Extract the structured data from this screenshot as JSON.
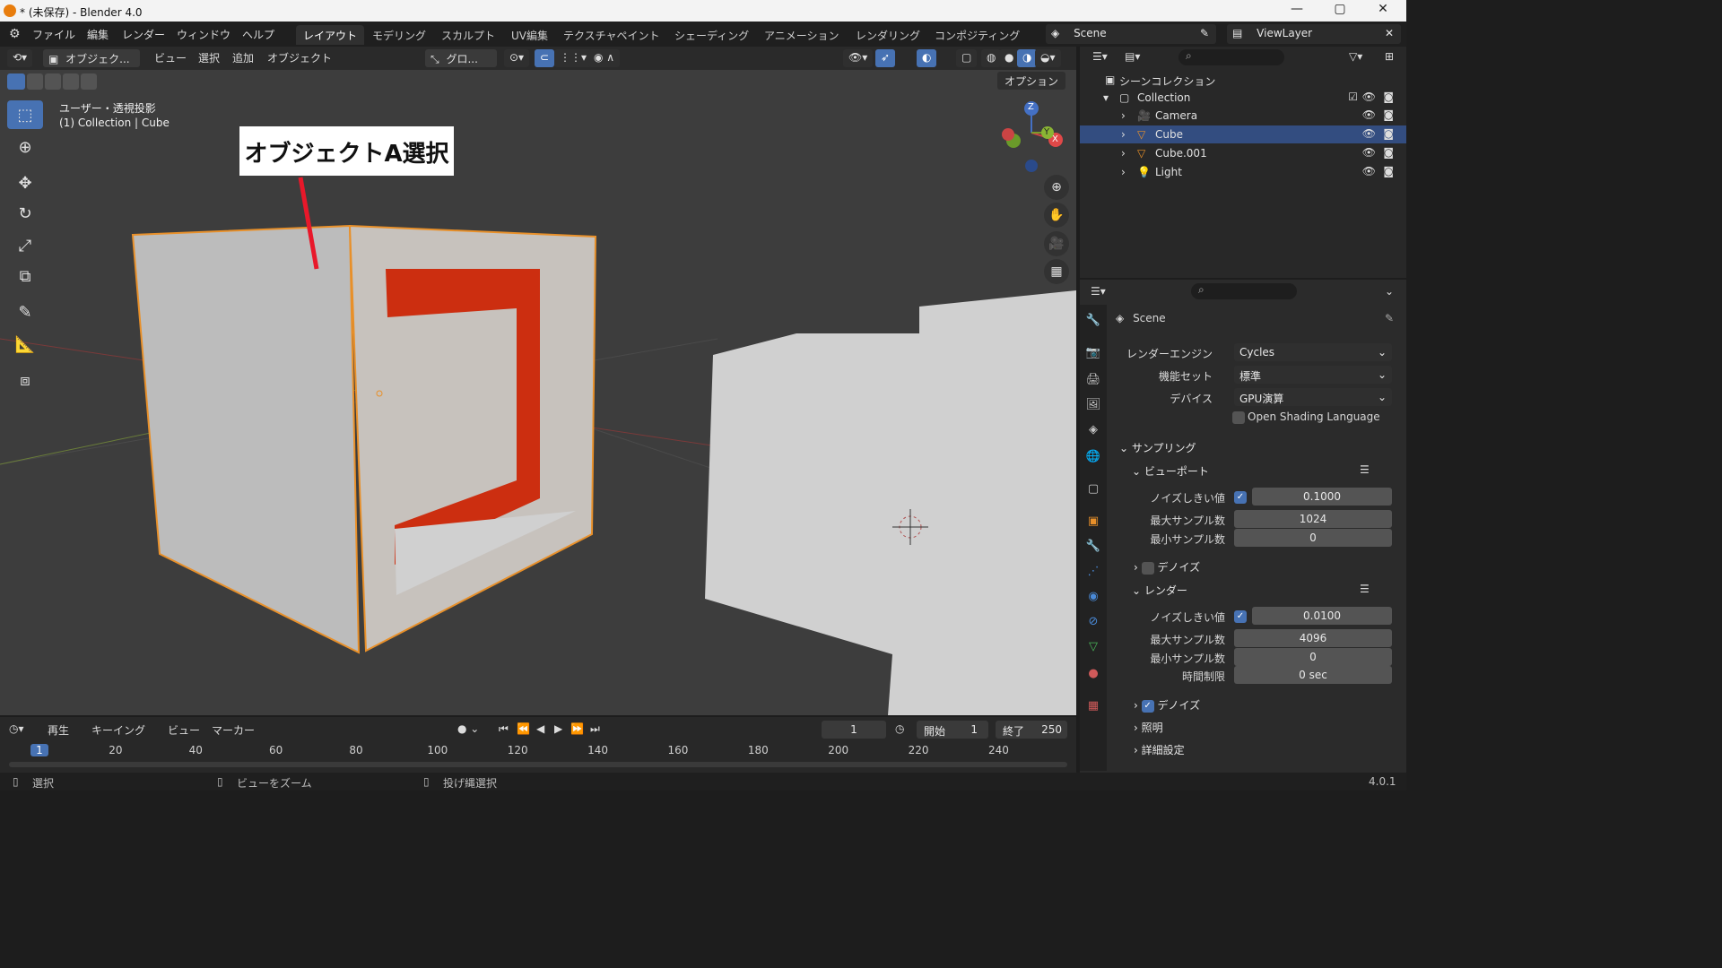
{
  "window": {
    "title": "* (未保存) - Blender 4.0",
    "minimize": "—",
    "maximize": "▢",
    "close": "✕"
  },
  "menu": {
    "items": [
      "ファイル",
      "編集",
      "レンダー",
      "ウィンドウ",
      "ヘルプ"
    ]
  },
  "workspaces": [
    "レイアウト",
    "モデリング",
    "スカルプト",
    "UV編集",
    "テクスチャペイント",
    "シェーディング",
    "アニメーション",
    "レンダリング",
    "コンポジティング"
  ],
  "scene": {
    "name": "Scene",
    "view_layer": "ViewLayer"
  },
  "viewport_header": {
    "mode": "オブジェク...",
    "menus": [
      "ビュー",
      "選択",
      "追加",
      "オブジェクト"
    ],
    "transform": "グロ...",
    "options": "オプション"
  },
  "viewport": {
    "view_label": "ユーザー・透視投影",
    "collection_label": "(1) Collection | Cube",
    "annotation": "オブジェクトA選択",
    "gizmo": {
      "z": "Z",
      "y": "Y",
      "x": "X"
    }
  },
  "outliner": {
    "root": "シーンコレクション",
    "collection": "Collection",
    "items": [
      {
        "name": "Camera",
        "selected": false,
        "icon": "camera-icon"
      },
      {
        "name": "Cube",
        "selected": true,
        "icon": "mesh-icon"
      },
      {
        "name": "Cube.001",
        "selected": false,
        "icon": "mesh-icon"
      },
      {
        "name": "Light",
        "selected": false,
        "icon": "light-icon"
      }
    ]
  },
  "properties": {
    "scene_name": "Scene",
    "render_engine_label": "レンダーエンジン",
    "render_engine": "Cycles",
    "feature_set_label": "機能セット",
    "feature_set": "標準",
    "device_label": "デバイス",
    "device": "GPU演算",
    "osl_label": "Open Shading Language",
    "sampling": "サンプリング",
    "viewport": "ビューポート",
    "noise_label": "ノイズしきい値",
    "viewport_noise": "0.1000",
    "max_samples_label": "最大サンプル数",
    "viewport_max": "1024",
    "min_samples_label": "最小サンプル数",
    "viewport_min": "0",
    "denoise_label": "デノイズ",
    "render": "レンダー",
    "render_noise": "0.0100",
    "render_max": "4096",
    "render_min": "0",
    "time_limit_label": "時間制限",
    "time_limit": "0 sec",
    "render_denoise_label": "デノイズ",
    "lighting": "照明",
    "advanced": "詳細設定"
  },
  "timeline": {
    "menus": [
      "再生",
      "キーイング",
      "ビュー",
      "マーカー"
    ],
    "current_frame": "1",
    "start_label": "開始",
    "start": "1",
    "end_label": "終了",
    "end": "250",
    "ticks": [
      "1",
      "20",
      "40",
      "60",
      "80",
      "100",
      "120",
      "140",
      "160",
      "180",
      "200",
      "220",
      "240"
    ]
  },
  "status": {
    "select": "選択",
    "zoom": "ビューをズーム",
    "lasso": "投げ縄選択",
    "version": "4.0.1"
  }
}
